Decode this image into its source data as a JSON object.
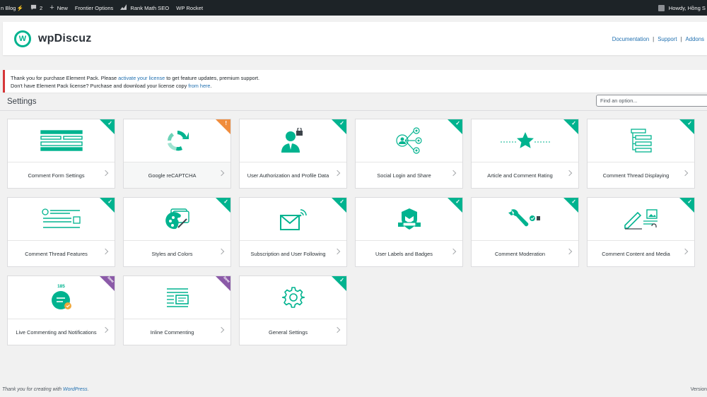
{
  "adminbar": {
    "site": "n Blog",
    "site_glyph": "⚡",
    "comments": "2",
    "new": "New",
    "frontier": "Frontier Options",
    "rankmath": "Rank Math SEO",
    "rocket": "WP Rocket",
    "howdy": "Howdy, Hồng S"
  },
  "header": {
    "logo_letter": "W",
    "logo_text": "wpDiscuz",
    "links": [
      "Documentation",
      "Support",
      "Addons"
    ],
    "sep": "|"
  },
  "notice": {
    "l1_before": "Thank you for purchase Element Pack. Please ",
    "l1_link": "activate your license",
    "l1_after": " to get feature updates, premium support.",
    "l2_before": "Don't have Element Pack license? Purchase and download your license copy ",
    "l2_link": "from here",
    "l2_after": "."
  },
  "settings": {
    "title": "Settings",
    "search_placeholder": "Find an option..."
  },
  "cards": [
    {
      "label": "Comment Form Settings",
      "badge": "check",
      "icon": "form-icon"
    },
    {
      "label": "Google reCAPTCHA",
      "badge": "warn",
      "icon": "recaptcha-icon"
    },
    {
      "label": "User Authorization and Profile Data",
      "badge": "check",
      "icon": "user-lock-icon"
    },
    {
      "label": "Social Login and Share",
      "badge": "check",
      "icon": "social-network-icon"
    },
    {
      "label": "Article and Comment Rating",
      "badge": "check",
      "icon": "star-icon"
    },
    {
      "label": "Comment Thread Displaying",
      "badge": "check",
      "icon": "thread-tree-icon"
    },
    {
      "label": "Comment Thread Features",
      "badge": "check",
      "icon": "thread-features-icon"
    },
    {
      "label": "Styles and Colors",
      "badge": "check",
      "icon": "palette-icon"
    },
    {
      "label": "Subscription and User Following",
      "badge": "check",
      "icon": "envelope-icon"
    },
    {
      "label": "User Labels and Badges",
      "badge": "check",
      "icon": "shield-badge-icon"
    },
    {
      "label": "Comment Moderation",
      "badge": "check",
      "icon": "wrench-icon"
    },
    {
      "label": "Comment Content and Media",
      "badge": "check",
      "icon": "content-media-icon"
    },
    {
      "label": "Live Commenting and Notifications",
      "badge": "new",
      "icon": "live-chat-icon",
      "count": "185"
    },
    {
      "label": "Inline Commenting",
      "badge": "new",
      "icon": "inline-comment-icon"
    },
    {
      "label": "General Settings",
      "badge": "check",
      "icon": "gear-icon"
    }
  ],
  "badges": {
    "check": "✓",
    "warn": "!",
    "new": "New"
  },
  "footer": {
    "left_before": "Thank you for creating with ",
    "left_link": "WordPress",
    "left_after": ".",
    "right": "Version"
  },
  "colors": {
    "accent": "#00b38f",
    "warn": "#f08c3c",
    "new": "#8b5aa8",
    "link": "#2271b1",
    "notice_border": "#d63638"
  }
}
